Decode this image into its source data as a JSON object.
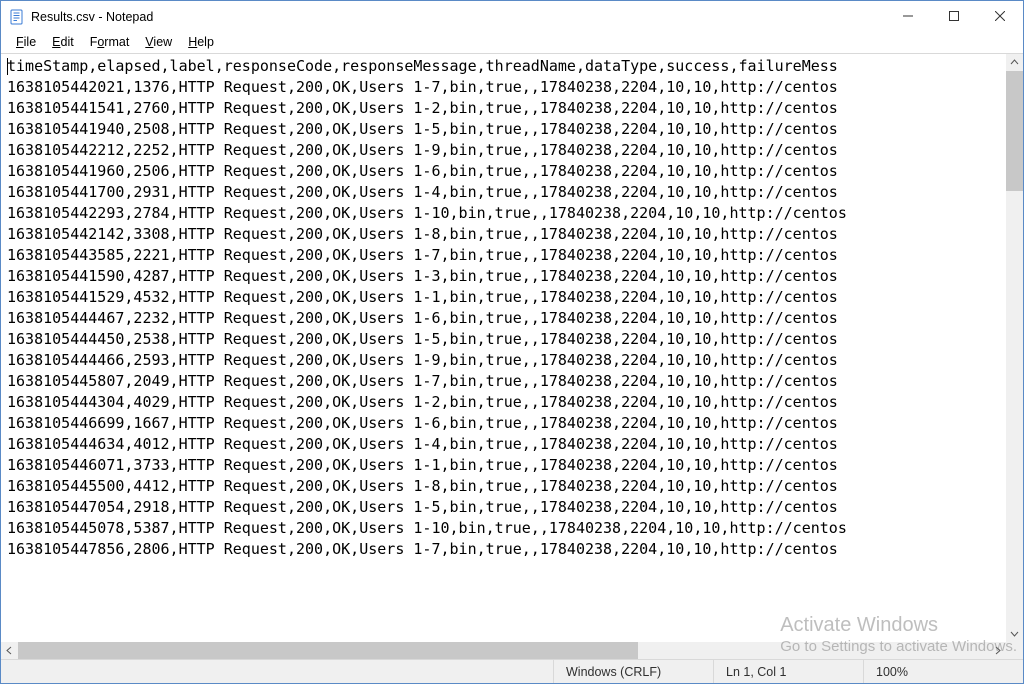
{
  "window": {
    "title": "Results.csv - Notepad"
  },
  "menu": {
    "file": "File",
    "edit": "Edit",
    "format": "Format",
    "view": "View",
    "help": "Help"
  },
  "csv": {
    "header": "timeStamp,elapsed,label,responseCode,responseMessage,threadName,dataType,success,failureMess",
    "rows": [
      {
        "timestamp": "1638105442021",
        "elapsed": "1376",
        "thread": "Users 1-7"
      },
      {
        "timestamp": "1638105441541",
        "elapsed": "2760",
        "thread": "Users 1-2"
      },
      {
        "timestamp": "1638105441940",
        "elapsed": "2508",
        "thread": "Users 1-5"
      },
      {
        "timestamp": "1638105442212",
        "elapsed": "2252",
        "thread": "Users 1-9"
      },
      {
        "timestamp": "1638105441960",
        "elapsed": "2506",
        "thread": "Users 1-6"
      },
      {
        "timestamp": "1638105441700",
        "elapsed": "2931",
        "thread": "Users 1-4"
      },
      {
        "timestamp": "1638105442293",
        "elapsed": "2784",
        "thread": "Users 1-10"
      },
      {
        "timestamp": "1638105442142",
        "elapsed": "3308",
        "thread": "Users 1-8"
      },
      {
        "timestamp": "1638105443585",
        "elapsed": "2221",
        "thread": "Users 1-7"
      },
      {
        "timestamp": "1638105441590",
        "elapsed": "4287",
        "thread": "Users 1-3"
      },
      {
        "timestamp": "1638105441529",
        "elapsed": "4532",
        "thread": "Users 1-1"
      },
      {
        "timestamp": "1638105444467",
        "elapsed": "2232",
        "thread": "Users 1-6"
      },
      {
        "timestamp": "1638105444450",
        "elapsed": "2538",
        "thread": "Users 1-5"
      },
      {
        "timestamp": "1638105444466",
        "elapsed": "2593",
        "thread": "Users 1-9"
      },
      {
        "timestamp": "1638105445807",
        "elapsed": "2049",
        "thread": "Users 1-7"
      },
      {
        "timestamp": "1638105444304",
        "elapsed": "4029",
        "thread": "Users 1-2"
      },
      {
        "timestamp": "1638105446699",
        "elapsed": "1667",
        "thread": "Users 1-6"
      },
      {
        "timestamp": "1638105444634",
        "elapsed": "4012",
        "thread": "Users 1-4"
      },
      {
        "timestamp": "1638105446071",
        "elapsed": "3733",
        "thread": "Users 1-1"
      },
      {
        "timestamp": "1638105445500",
        "elapsed": "4412",
        "thread": "Users 1-8"
      },
      {
        "timestamp": "1638105447054",
        "elapsed": "2918",
        "thread": "Users 1-5"
      },
      {
        "timestamp": "1638105445078",
        "elapsed": "5387",
        "thread": "Users 1-10"
      },
      {
        "timestamp": "1638105447856",
        "elapsed": "2806",
        "thread": "Users 1-7"
      }
    ],
    "row_template_a": ",HTTP Request,200,OK,",
    "row_template_b": ",bin,true,,17840238,2204,10,10,http://centos"
  },
  "status": {
    "encoding": "Windows (CRLF)",
    "position": "Ln 1, Col 1",
    "zoom": "100%"
  },
  "watermark": {
    "line1": "Activate Windows",
    "line2": "Go to Settings to activate Windows."
  }
}
